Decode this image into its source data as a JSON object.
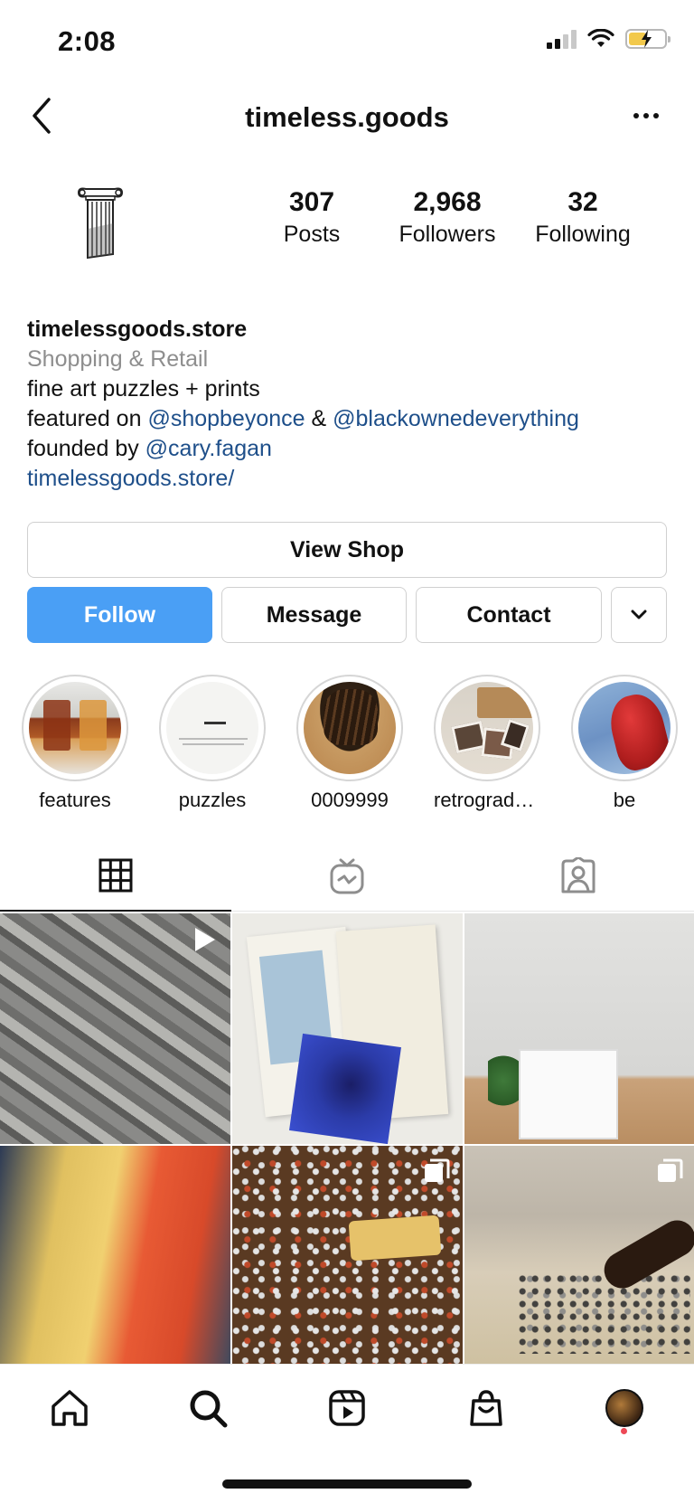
{
  "status_bar": {
    "time": "2:08"
  },
  "header": {
    "username": "timeless.goods"
  },
  "stats": [
    {
      "value": "307",
      "label": "Posts"
    },
    {
      "value": "2,968",
      "label": "Followers"
    },
    {
      "value": "32",
      "label": "Following"
    }
  ],
  "bio": {
    "name": "timelessgoods.store",
    "category": "Shopping & Retail",
    "line1": "fine art puzzles + prints",
    "featured_prefix": "featured on ",
    "mention1": "@shopbeyonce",
    "amp": " & ",
    "mention2": "@blackownedeverything",
    "founded_prefix": "founded by ",
    "mention3": "@cary.fagan",
    "website": "timelessgoods.store/"
  },
  "buttons": {
    "view_shop": "View Shop",
    "follow": "Follow",
    "message": "Message",
    "contact": "Contact"
  },
  "highlights": [
    {
      "label": "features"
    },
    {
      "label": "puzzles"
    },
    {
      "label": "0009999"
    },
    {
      "label": "retrograde..."
    },
    {
      "label": "be"
    }
  ],
  "colors": {
    "follow_blue": "#4a9ff5",
    "link_blue": "#1e4f8a",
    "notification_red": "#ed4956"
  }
}
